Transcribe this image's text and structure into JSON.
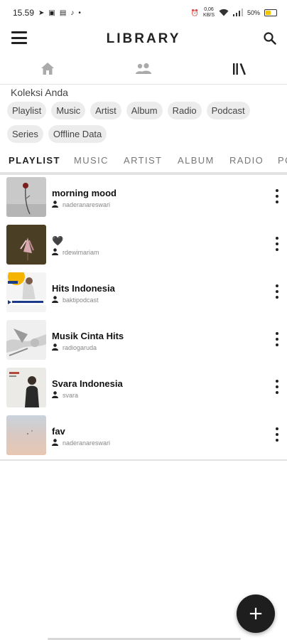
{
  "status_bar": {
    "time": "15.59",
    "network_speed_top": "0,06",
    "network_speed_bottom": "KB/S",
    "battery": "50%",
    "battery_level": 0.5,
    "battery_color": "#f5c400"
  },
  "app_bar": {
    "title": "LIBRARY",
    "menu_icon": "hamburger-menu-icon",
    "search_icon": "search-icon"
  },
  "top_nav": [
    {
      "icon": "home-icon"
    },
    {
      "icon": "friends-icon"
    },
    {
      "icon": "library-icon",
      "active": true
    }
  ],
  "collection": {
    "title": "Koleksi Anda",
    "chips": [
      "Playlist",
      "Music",
      "Artist",
      "Album",
      "Radio",
      "Podcast",
      "Series",
      "Offline Data"
    ]
  },
  "tabs": [
    "PLAYLIST",
    "MUSIC",
    "ARTIST",
    "ALBUM",
    "RADIO",
    "PO"
  ],
  "active_tab": 0,
  "playlists": [
    {
      "title": "morning mood",
      "owner": "naderanareswari",
      "thumb": "rose-photo"
    },
    {
      "title": "🖤",
      "owner": "rdewimariam",
      "thumb": "dried-flowers-photo"
    },
    {
      "title": "Hits Indonesia",
      "owner": "baktipodcast",
      "thumb": "hits-indonesia-cover"
    },
    {
      "title": "Musik Cinta Hits",
      "owner": "radiogaruda",
      "thumb": "abstract-bw-cover"
    },
    {
      "title": "Svara Indonesia",
      "owner": "svara",
      "thumb": "svara-indonesia-cover"
    },
    {
      "title": "fav",
      "owner": "naderanareswari",
      "thumb": "beach-photo"
    }
  ],
  "fab": {
    "label": "+",
    "icon": "add-icon"
  }
}
